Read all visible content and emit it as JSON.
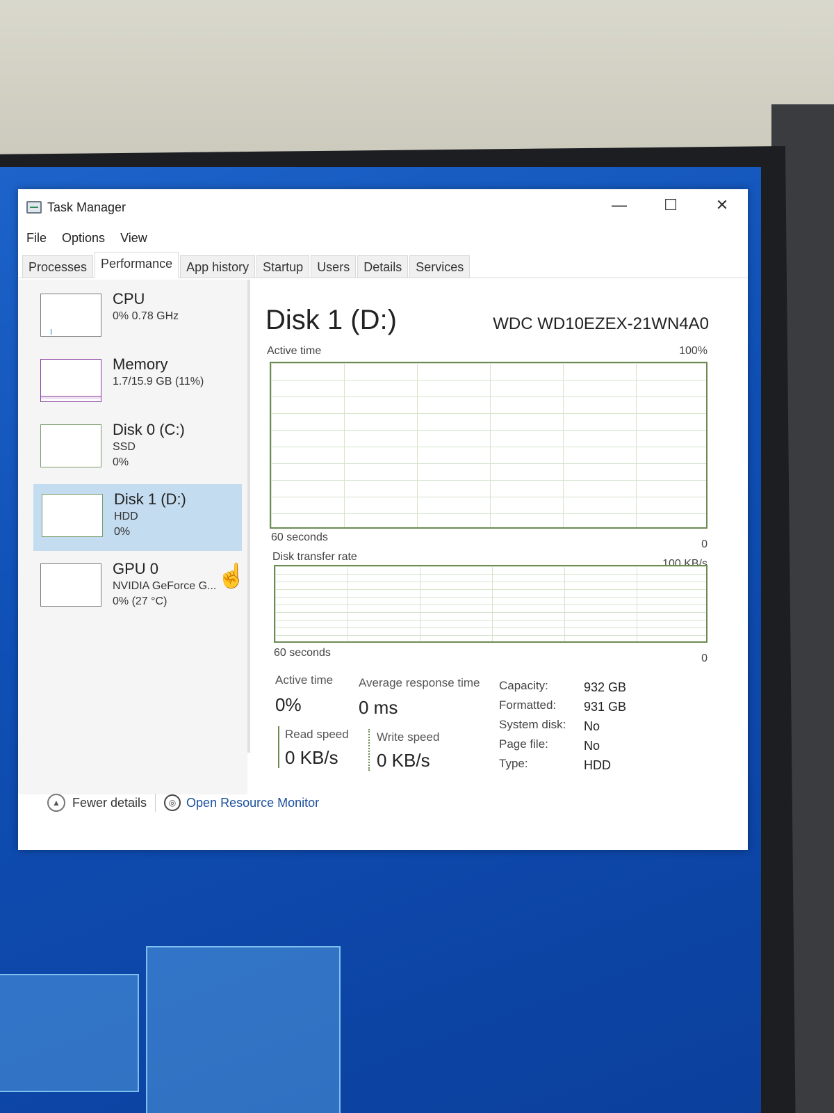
{
  "window": {
    "title": "Task Manager",
    "controls": {
      "minimize": "—",
      "maximize": "☐",
      "close": "✕"
    }
  },
  "menu": [
    "File",
    "Options",
    "View"
  ],
  "tabs": [
    "Processes",
    "Performance",
    "App history",
    "Startup",
    "Users",
    "Details",
    "Services"
  ],
  "active_tab": "Performance",
  "sidebar": {
    "items": [
      {
        "name": "CPU",
        "line1": "0% 0.78 GHz",
        "line2": ""
      },
      {
        "name": "Memory",
        "line1": "1.7/15.9 GB (11%)",
        "line2": ""
      },
      {
        "name": "Disk 0 (C:)",
        "line1": "SSD",
        "line2": "0%"
      },
      {
        "name": "Disk 1 (D:)",
        "line1": "HDD",
        "line2": "0%"
      },
      {
        "name": "GPU 0",
        "line1": "NVIDIA GeForce G...",
        "line2": "0% (27 °C)"
      }
    ],
    "selected": "Disk 1 (D:)"
  },
  "main": {
    "title": "Disk 1 (D:)",
    "model": "WDC WD10EZEX-21WN4A0",
    "graph1": {
      "label": "Active time",
      "max": "100%",
      "time": "60 seconds",
      "min": "0"
    },
    "graph2": {
      "label": "Disk transfer rate",
      "max": "100 KB/s",
      "time": "60 seconds",
      "min": "0"
    },
    "stats": {
      "active_time_label": "Active time",
      "active_time_value": "0%",
      "avg_response_label": "Average response time",
      "avg_response_value": "0 ms",
      "read_label": "Read speed",
      "read_value": "0 KB/s",
      "write_label": "Write speed",
      "write_value": "0 KB/s"
    },
    "properties": [
      {
        "key": "Capacity:",
        "value": "932 GB"
      },
      {
        "key": "Formatted:",
        "value": "931 GB"
      },
      {
        "key": "System disk:",
        "value": "No"
      },
      {
        "key": "Page file:",
        "value": "No"
      },
      {
        "key": "Type:",
        "value": "HDD"
      }
    ]
  },
  "footer": {
    "fewer_details": "Fewer details",
    "open_resource_monitor": "Open Resource Monitor"
  }
}
